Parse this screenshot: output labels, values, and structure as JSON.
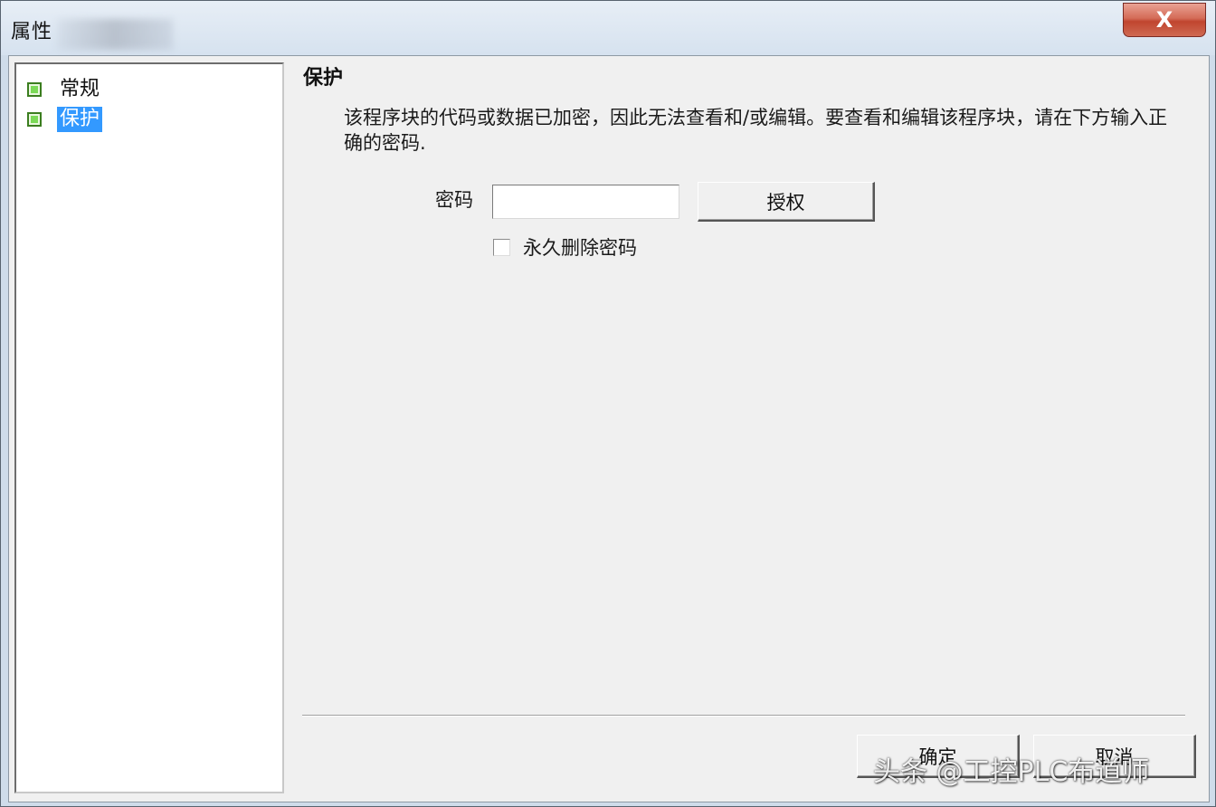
{
  "window": {
    "title": "属性"
  },
  "titlebar": {
    "close_symbol": "X"
  },
  "tree": {
    "items": [
      {
        "label": "常规",
        "icon": "green-square-icon",
        "selected": false
      },
      {
        "label": "保护",
        "icon": "green-square-icon",
        "selected": true
      }
    ]
  },
  "protection": {
    "title": "保护",
    "description": "该程序块的代码或数据已加密，因此无法查看和/或编辑。要查看和编辑该程序块，请在下方输入正确的密码.",
    "password_label": "密码",
    "password_value": "",
    "authorize_label": "授权",
    "delete_password_label": "永久删除密码",
    "delete_password_checked": false
  },
  "footer": {
    "ok_label": "确定",
    "cancel_label": "取消"
  },
  "watermark": {
    "text": "头条 @工控PLC布道师"
  },
  "colors": {
    "selection": "#3399ff",
    "close_button": "#c9503b",
    "tree_icon": "#7bd957"
  }
}
